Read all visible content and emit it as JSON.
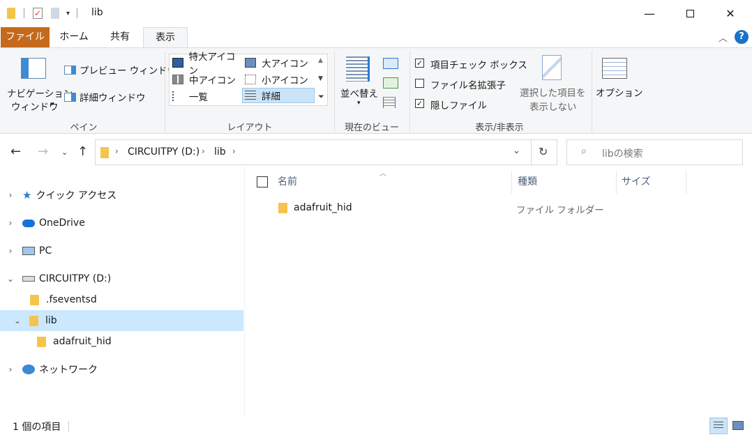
{
  "window": {
    "title": "lib",
    "minimize_icon": "minimize-icon",
    "maximize_icon": "maximize-icon",
    "close_icon": "close-icon"
  },
  "quick_access_icons": [
    "folder-icon",
    "properties-checkmark-icon",
    "new-folder-icon",
    "customize-dropdown-icon"
  ],
  "ribbon_tabs": {
    "file": "ファイル",
    "home": "ホーム",
    "share": "共有",
    "view": "表示"
  },
  "ribbon": {
    "pane": {
      "nav_pane_line1": "ナビゲーション",
      "nav_pane_line2": "ウィンドウ",
      "preview_pane": "プレビュー ウィンドウ",
      "details_pane": "詳細ウィンドウ",
      "label": "ペイン"
    },
    "layout": {
      "extra_large": "特大アイコン",
      "large": "大アイコン",
      "medium": "中アイコン",
      "small": "小アイコン",
      "list": "一覧",
      "details": "詳細",
      "label": "レイアウト"
    },
    "current_view": {
      "sort_by": "並べ替え",
      "label": "現在のビュー"
    },
    "show_hide": {
      "item_checkboxes": "項目チェック ボックス",
      "item_checkboxes_checked": true,
      "file_extensions": "ファイル名拡張子",
      "file_extensions_checked": false,
      "hidden_items": "隠しファイル",
      "hidden_items_checked": true,
      "hide_selected_line1": "選択した項目を",
      "hide_selected_line2": "表示しない",
      "label": "表示/非表示"
    },
    "options": "オプション"
  },
  "address": {
    "segments": [
      "CIRCUITPY (D:)",
      "lib"
    ],
    "search_placeholder": "libの検索"
  },
  "nav_pane": [
    {
      "label": "クイック アクセス",
      "icon": "star-icon",
      "expanded": false
    },
    {
      "label": "OneDrive",
      "icon": "cloud-icon",
      "expanded": false
    },
    {
      "label": "PC",
      "icon": "pc-icon",
      "expanded": false
    },
    {
      "label": "CIRCUITPY (D:)",
      "icon": "drive-icon",
      "expanded": true
    },
    {
      "label": ".fseventsd",
      "icon": "folder-icon"
    },
    {
      "label": "lib",
      "icon": "folder-icon",
      "expanded": true,
      "selected": true
    },
    {
      "label": "adafruit_hid",
      "icon": "folder-icon"
    },
    {
      "label": "ネットワーク",
      "icon": "network-icon",
      "expanded": false
    }
  ],
  "file_list": {
    "columns": [
      "名前",
      "種類",
      "サイズ"
    ],
    "rows": [
      {
        "name": "adafruit_hid",
        "type": "ファイル フォルダー",
        "size": ""
      }
    ]
  },
  "status_bar": {
    "item_count": "1 個の項目"
  },
  "colors": {
    "file_tab": "#c56a1c",
    "selection": "#cce8ff",
    "folder": "#f5c44d",
    "help": "#1a73c8"
  }
}
